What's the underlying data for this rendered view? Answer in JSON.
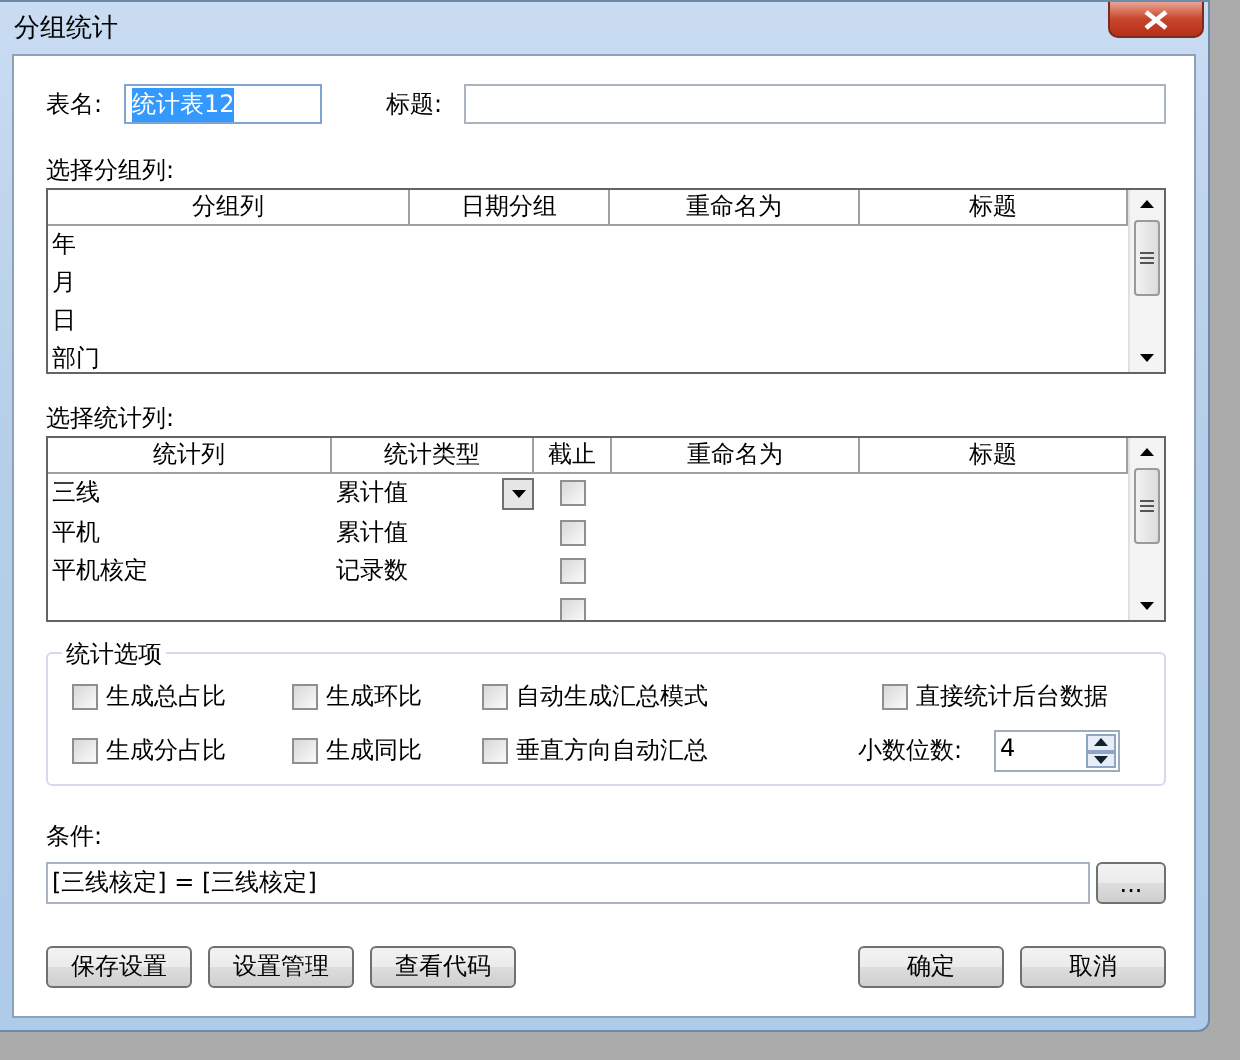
{
  "window": {
    "title": "分组统计"
  },
  "table_name": {
    "label": "表名:",
    "value": "统计表12",
    "text_selected": true
  },
  "caption": {
    "label": "标题:"
  },
  "group_section": {
    "label": "选择分组列:",
    "columns": [
      "分组列",
      "日期分组",
      "重命名为",
      "标题"
    ],
    "rows": [
      {
        "column": "年"
      },
      {
        "column": "月"
      },
      {
        "column": "日"
      },
      {
        "column": "部门"
      }
    ]
  },
  "stat_section": {
    "label": "选择统计列:",
    "columns": [
      "统计列",
      "统计类型",
      "截止",
      "重命名为",
      "标题"
    ],
    "rows": [
      {
        "column": "三线",
        "type": "累计值",
        "dropdown": true,
        "checked": false
      },
      {
        "column": "平机",
        "type": "累计值",
        "dropdown": false,
        "checked": false
      },
      {
        "column": "平机核定",
        "type": "记录数",
        "dropdown": false,
        "checked": false
      },
      {
        "dropdown": false,
        "checked": false
      }
    ]
  },
  "options": {
    "title": "统计选项",
    "checkboxes": [
      {
        "label": "生成总占比",
        "checked": false
      },
      {
        "label": "生成环比",
        "checked": false
      },
      {
        "label": "自动生成汇总模式",
        "checked": false
      },
      {
        "label": "直接统计后台数据",
        "checked": false
      },
      {
        "label": "生成分占比",
        "checked": false
      },
      {
        "label": "生成同比",
        "checked": false
      },
      {
        "label": "垂直方向自动汇总",
        "checked": false
      }
    ],
    "decimals": {
      "label": "小数位数:",
      "value": "4"
    }
  },
  "condition": {
    "label": "条件:",
    "value": "[三线核定] = [三线核定]",
    "button": "..."
  },
  "buttons_left": [
    "保存设置",
    "设置管理",
    "查看代码"
  ],
  "buttons_right": [
    "确定",
    "取消"
  ]
}
